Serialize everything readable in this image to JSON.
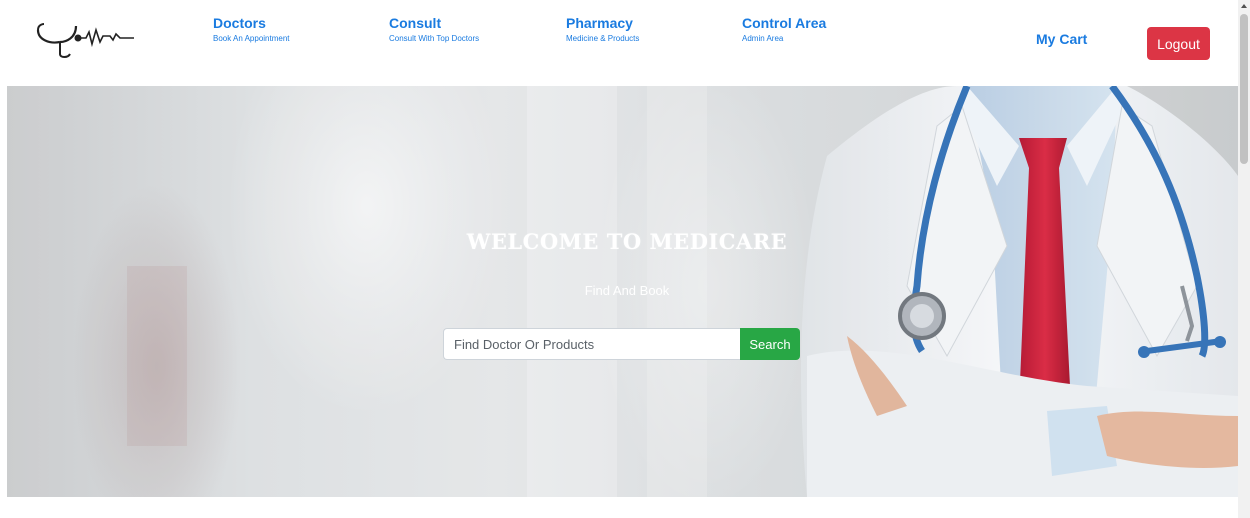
{
  "nav": {
    "logo_icon": "stethoscope-heartbeat-icon",
    "items": [
      {
        "title": "Doctors",
        "subtitle": "Book An Appointment"
      },
      {
        "title": "Consult",
        "subtitle": "Consult With Top Doctors"
      },
      {
        "title": "Pharmacy",
        "subtitle": "Medicine & Products"
      },
      {
        "title": "Control Area",
        "subtitle": "Admin Area"
      }
    ],
    "cart_label": "My Cart",
    "logout_label": "Logout"
  },
  "hero": {
    "title": "WELCOME TO MEDICARE",
    "subtitle": "Find And Book",
    "image": "doctor-with-stethoscope-photo"
  },
  "search": {
    "placeholder": "Find Doctor Or Products",
    "button_label": "Search"
  },
  "colors": {
    "link": "#1a7be0",
    "logout": "#dc3545",
    "search_button": "#28a745"
  }
}
